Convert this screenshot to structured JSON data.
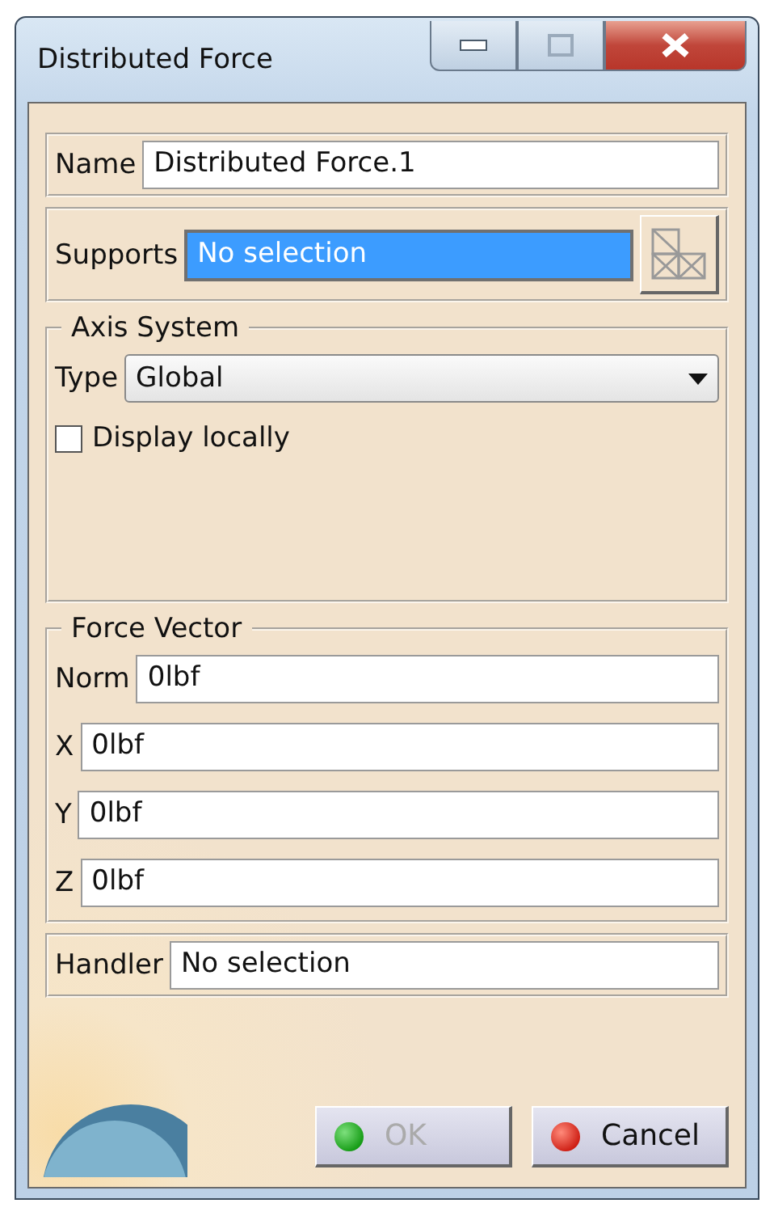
{
  "window": {
    "title": "Distributed Force"
  },
  "name": {
    "label": "Name",
    "value": "Distributed Force.1"
  },
  "supports": {
    "label": "Supports",
    "value": "No selection",
    "selected": true
  },
  "axis_system": {
    "title": "Axis System",
    "type_label": "Type",
    "type_value": "Global",
    "display_locally": {
      "label": "Display locally",
      "checked": false
    }
  },
  "force_vector": {
    "title": "Force Vector",
    "fields": [
      {
        "label": "Norm",
        "value": "0lbf"
      },
      {
        "label": "X",
        "value": "0lbf"
      },
      {
        "label": "Y",
        "value": "0lbf"
      },
      {
        "label": "Z",
        "value": "0lbf"
      }
    ]
  },
  "handler": {
    "label": "Handler",
    "value": "No selection"
  },
  "buttons": [
    {
      "label": "OK",
      "kind": "ok",
      "disabled": true
    },
    {
      "label": "Cancel",
      "kind": "cancel",
      "disabled": false
    }
  ]
}
